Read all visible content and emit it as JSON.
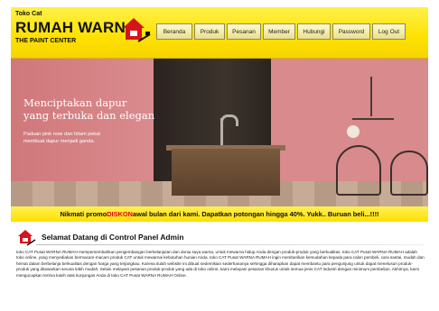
{
  "header": {
    "tagline": "Toko Cat",
    "brand": "RUMAH WARNA",
    "subtitle": "THE PAINT CENTER"
  },
  "nav": {
    "items": [
      {
        "label": "Beranda"
      },
      {
        "label": "Produk"
      },
      {
        "label": "Pesanan"
      },
      {
        "label": "Member"
      },
      {
        "label": "Hubungi"
      },
      {
        "label": "Password"
      },
      {
        "label": "Log Out"
      }
    ]
  },
  "banner": {
    "headline_line1": "Menciptakan dapur",
    "headline_line2": "yang terbuka dan elegan",
    "subline_line1": "Paduan pink rose dan hitam pekat",
    "subline_line2": "membuat dapur menjadi ganda."
  },
  "promo": {
    "before": "Nikmati promo ",
    "highlight": "DISKON",
    "after": " awal bulan dari kami. Dapatkan potongan hingga 40%. Yukk.. Buruan beli...!!!!"
  },
  "welcome": {
    "title": "Selamat Datang di Control Panel Admin",
    "body": "toko CAT Pusat WARNA RUMAH mempersembahkan pengembangan berkelanjutan dan dunia saya warna, untuk mewarna hidup Anda dengan produk-produk yang berkualitas. toko CAT Pusat WARNA RUMAH adalah toko online, yang menyediakan bermacam-macam produk CAT untuk mewarnai kebutuhan hunian Anda. toko CAT Pusat WARNA RUMAH ingin memberikan kemudahan kepada para calon pembeli, cara santai, mudah dan hemat dalam berbelanja berkualitas dengan harga yang terjangkau. Karena itulah website ini dibuat sedemikian sederhananya sehingga diharapkan dapat membantu para pengunjung untuk dapat menelusuri produk-produk yang ditawarkan secara lebih mudah. Selain melayani pesanan produk-produk yang ada di toko online, kami melayani pesanan khusus untuk semua jenis CAT industri dengan minimum pembelian. Akhirnya, kami mengucapkan terima kasih atas kunjungan Anda di toko CAT Pusat WARNA RUMAH Online."
  },
  "colors": {
    "header_yellow": "#ffe100",
    "banner_pink": "#d98a8c",
    "promo_highlight": "#e0001b",
    "logo_red": "#d6141b"
  },
  "icons": {
    "logo": "paint-house-icon",
    "welcome": "paint-house-icon"
  }
}
